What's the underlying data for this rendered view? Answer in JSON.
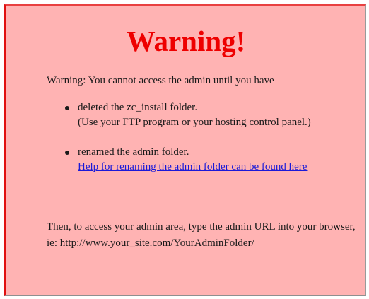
{
  "warning": {
    "title": "Warning!",
    "intro": "Warning: You cannot access the admin until you have",
    "steps": [
      {
        "line1": "deleted the zc_install folder.",
        "line2": "(Use your FTP program or your hosting control panel.)"
      },
      {
        "line1": "renamed the admin folder.",
        "link_text": "Help for renaming the admin folder can be found here"
      }
    ],
    "outro": {
      "text": "Then, to access your admin area, type the admin URL into your browser, ie: ",
      "url_text": "http://www.your_site.com/YourAdminFolder/"
    }
  },
  "colors": {
    "background": "#ffb3b3",
    "title": "#ee0000",
    "link": "#1a1ad8"
  }
}
